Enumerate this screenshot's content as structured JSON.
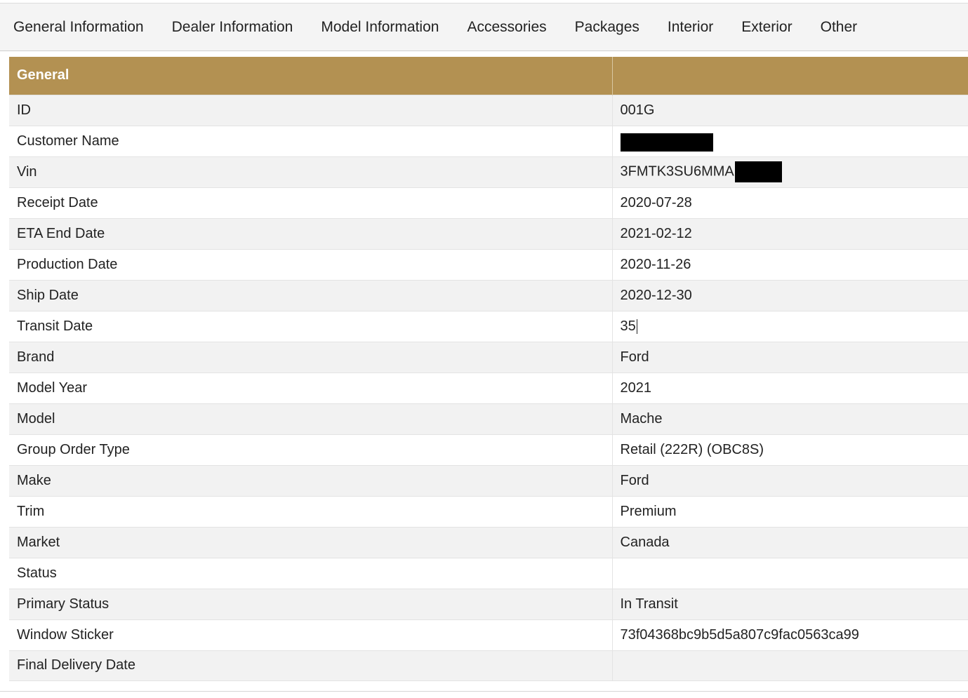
{
  "tabs": [
    {
      "label": "General Information"
    },
    {
      "label": "Dealer Information"
    },
    {
      "label": "Model Information"
    },
    {
      "label": "Accessories"
    },
    {
      "label": "Packages"
    },
    {
      "label": "Interior"
    },
    {
      "label": "Exterior"
    },
    {
      "label": "Other"
    }
  ],
  "table": {
    "header": "General",
    "header_value": "",
    "rows": [
      {
        "label": "ID",
        "value": "001G"
      },
      {
        "label": "Customer Name",
        "value": ""
      },
      {
        "label": "Vin",
        "value": "3FMTK3SU6MMA"
      },
      {
        "label": "Receipt Date",
        "value": "2020-07-28"
      },
      {
        "label": "ETA End Date",
        "value": "2021-02-12"
      },
      {
        "label": "Production Date",
        "value": "2020-11-26"
      },
      {
        "label": "Ship Date",
        "value": "2020-12-30"
      },
      {
        "label": "Transit Date",
        "value": "35"
      },
      {
        "label": "Brand",
        "value": "Ford"
      },
      {
        "label": "Model Year",
        "value": "2021"
      },
      {
        "label": "Model",
        "value": "Mache"
      },
      {
        "label": "Group Order Type",
        "value": "Retail (222R) (OBC8S)"
      },
      {
        "label": "Make",
        "value": "Ford"
      },
      {
        "label": "Trim",
        "value": "Premium"
      },
      {
        "label": "Market",
        "value": "Canada"
      },
      {
        "label": "Status",
        "value": ""
      },
      {
        "label": "Primary Status",
        "value": "In Transit"
      },
      {
        "label": "Window Sticker",
        "value": "73f04368bc9b5d5a807c9fac0563ca99"
      },
      {
        "label": "Final Delivery Date",
        "value": ""
      }
    ]
  },
  "colors": {
    "header_bg": "#b39152",
    "row_alt_bg": "#f2f2f2",
    "tabbar_bg": "#f4f4f4"
  }
}
